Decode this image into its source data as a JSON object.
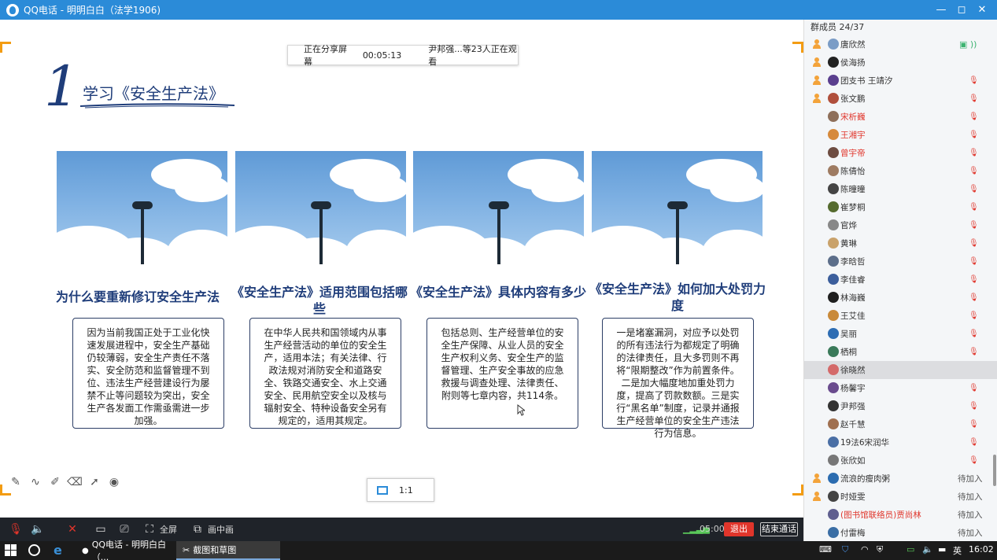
{
  "window": {
    "title": "QQ电话 - 明明白白（法学1906)",
    "controls": [
      "—",
      "◻",
      "✕"
    ]
  },
  "share_status": {
    "sharing": "正在分享屏幕",
    "duration": "00:05:13",
    "viewers": "尹邦强...等23人正在观看"
  },
  "slide": {
    "number": "1",
    "title": "学习《安全生产法》",
    "columns": [
      {
        "title": "为什么要重新修订安全生产法",
        "body": "因为当前我国正处于工业化快速发展进程中，安全生产基础仍较薄弱，安全生产责任不落实、安全防范和监督管理不到位、违法生产经营建设行为屡禁不止等问题较为突出，安全生产各发面工作需亟需进一步加强。"
      },
      {
        "title": "《安全生产法》适用范围包括哪些",
        "body": "在中华人民共和国领域内从事生产经营活动的单位的安全生产，适用本法；有关法律、行政法规对消防安全和道路安全、铁路交通安全、水上交通安全、民用航空安全以及核与辐射安全、特种设备安全另有规定的，适用其规定。"
      },
      {
        "title": "《安全生产法》具体内容有多少",
        "body": "包括总则、生产经营单位的安全生产保障、从业人员的安全生产权利义务、安全生产的监督管理、生产安全事故的应急救援与调查处理、法律责任、附则等七章内容，共114条。"
      },
      {
        "title": "《安全生产法》如何加大处罚力度",
        "body": "一是堵塞漏洞，对应予以处罚的所有违法行为都规定了明确的法律责任，且大多罚则不再将“限期整改”作为前置条件。二是加大幅度地加重处罚力度，提高了罚款数额。三是实行“黑名单”制度，记录并通报生产经营单位的安全生产违法行为信息。"
      }
    ]
  },
  "annotation_tools": [
    "pen-icon",
    "curve-icon",
    "highlighter-icon",
    "eraser-icon",
    "pointer-icon",
    "laser-icon"
  ],
  "zoom": {
    "ratio": "1:1"
  },
  "call_toolbar": {
    "fullscreen": "全屏",
    "pip": "画中画",
    "timer": "05:00",
    "exit": "退出",
    "end_call": "结束通话"
  },
  "members": {
    "header": "群成员 24/37",
    "list": [
      {
        "name": "唐欣然",
        "role": "admin",
        "mic": "on",
        "color": "#333333",
        "avatar": "#7a9cc6"
      },
      {
        "name": "侯海扬",
        "role": "admin",
        "mic": "",
        "color": "#333333",
        "avatar": "#222222"
      },
      {
        "name": "团支书 王靖汐",
        "role": "admin",
        "mic": "off",
        "color": "#333333",
        "avatar": "#5a3f8e"
      },
      {
        "name": "张文鹏",
        "role": "admin",
        "mic": "off",
        "color": "#333333",
        "avatar": "#b04f3c"
      },
      {
        "name": "宋析巍",
        "role": "",
        "mic": "off",
        "color": "#e0352b",
        "avatar": "#8e6f5a"
      },
      {
        "name": "王湘宇",
        "role": "",
        "mic": "off",
        "color": "#e0352b",
        "avatar": "#d68a3c"
      },
      {
        "name": "曾宇帝",
        "role": "",
        "mic": "off",
        "color": "#e0352b",
        "avatar": "#6d4c41"
      },
      {
        "name": "陈倩怡",
        "role": "",
        "mic": "off",
        "color": "#333333",
        "avatar": "#9e7b62"
      },
      {
        "name": "陈曈曈",
        "role": "",
        "mic": "off",
        "color": "#333333",
        "avatar": "#444444"
      },
      {
        "name": "崔梦桐",
        "role": "",
        "mic": "off",
        "color": "#333333",
        "avatar": "#556b2f"
      },
      {
        "name": "官烨",
        "role": "",
        "mic": "off",
        "color": "#333333",
        "avatar": "#888888"
      },
      {
        "name": "黄琳",
        "role": "",
        "mic": "off",
        "color": "#333333",
        "avatar": "#c9a26b"
      },
      {
        "name": "李晗哲",
        "role": "",
        "mic": "off",
        "color": "#333333",
        "avatar": "#5c6e8a"
      },
      {
        "name": "李佳睿",
        "role": "",
        "mic": "off",
        "color": "#333333",
        "avatar": "#3b5e9c"
      },
      {
        "name": "林海巍",
        "role": "",
        "mic": "off",
        "color": "#333333",
        "avatar": "#1f1f1f"
      },
      {
        "name": "王艾佳",
        "role": "",
        "mic": "off",
        "color": "#333333",
        "avatar": "#c98a3a"
      },
      {
        "name": "吴丽",
        "role": "",
        "mic": "off",
        "color": "#333333",
        "avatar": "#2e6db3"
      },
      {
        "name": "栖桐",
        "role": "",
        "mic": "off",
        "color": "#333333",
        "avatar": "#3a7a5a"
      },
      {
        "name": "徐晓然",
        "role": "",
        "mic": "",
        "color": "#333333",
        "avatar": "#d46a6a"
      },
      {
        "name": "杨馨宇",
        "role": "",
        "mic": "off",
        "color": "#333333",
        "avatar": "#6a4c8e"
      },
      {
        "name": "尹邦强",
        "role": "",
        "mic": "off",
        "color": "#333333",
        "avatar": "#333333"
      },
      {
        "name": "赵千慧",
        "role": "",
        "mic": "off",
        "color": "#333333",
        "avatar": "#a07050"
      },
      {
        "name": "19法6宋润华",
        "role": "",
        "mic": "off",
        "color": "#333333",
        "avatar": "#4a6fa5"
      },
      {
        "name": "张欣如",
        "role": "",
        "mic": "off",
        "color": "#333333",
        "avatar": "#777777"
      },
      {
        "name": "流浪的瘦肉粥",
        "role": "admin",
        "status": "待加入",
        "color": "#333333",
        "avatar": "#2b6cb0"
      },
      {
        "name": "时娅雯",
        "role": "admin",
        "status": "待加入",
        "color": "#333333",
        "avatar": "#444444"
      },
      {
        "name": "(图书馆联络员)贾尚林",
        "role": "",
        "status": "待加入",
        "color": "#e0352b",
        "avatar": "#5f5f8f"
      },
      {
        "name": "付雷梅",
        "role": "",
        "status": "待加入",
        "color": "#333333",
        "avatar": "#3a6ea5"
      }
    ]
  },
  "taskbar": {
    "tasks": [
      "QQ电话 - 明明白白（...",
      "截图和草图"
    ],
    "ime": "英",
    "clock": "16:02"
  }
}
